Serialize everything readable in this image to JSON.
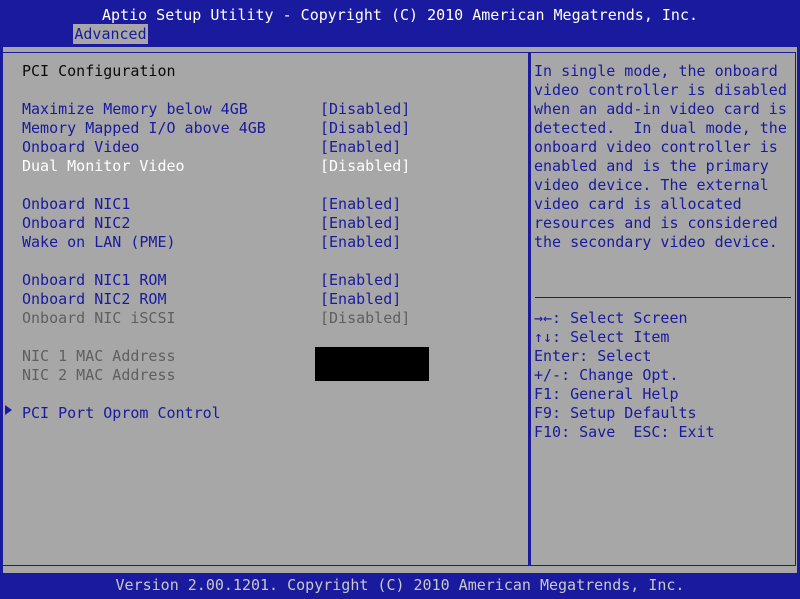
{
  "header": {
    "title": "Aptio Setup Utility - Copyright (C) 2010 American Megatrends, Inc.",
    "active_tab": "Advanced"
  },
  "page": {
    "title": "PCI Configuration"
  },
  "settings": [
    {
      "label": "Maximize Memory below 4GB",
      "value": "[Disabled]"
    },
    {
      "label": "Memory Mapped I/O above 4GB",
      "value": "[Disabled]"
    },
    {
      "label": "Onboard Video",
      "value": "[Enabled]"
    },
    {
      "label": "Dual Monitor Video",
      "value": "[Disabled]"
    },
    {
      "label": "Onboard NIC1",
      "value": "[Enabled]"
    },
    {
      "label": "Onboard NIC2",
      "value": "[Enabled]"
    },
    {
      "label": "Wake on LAN (PME)",
      "value": "[Enabled]"
    },
    {
      "label": "Onboard NIC1 ROM",
      "value": "[Enabled]"
    },
    {
      "label": "Onboard NIC2 ROM",
      "value": "[Enabled]"
    },
    {
      "label": "Onboard NIC iSCSI",
      "value": "[Disabled]"
    },
    {
      "label": "NIC 1 MAC Address"
    },
    {
      "label": "NIC 2 MAC Address"
    }
  ],
  "submenu": {
    "label": "PCI Port Oprom Control"
  },
  "help": {
    "lines": [
      "In single mode, the onboard",
      "video controller is disabled",
      "when an add-in video card is",
      "detected.  In dual mode, the",
      "onboard video controller is",
      "enabled and is the primary",
      "video device. The external",
      "video card is allocated",
      "resources and is considered",
      "the secondary video device."
    ]
  },
  "keys": [
    "→←: Select Screen",
    "↑↓: Select Item",
    "Enter: Select",
    "+/-: Change Opt.",
    "F1: General Help",
    "F9: Setup Defaults",
    "F10: Save  ESC: Exit"
  ],
  "footer": {
    "text": "Version 2.00.1201. Copyright (C) 2010 American Megatrends, Inc."
  }
}
